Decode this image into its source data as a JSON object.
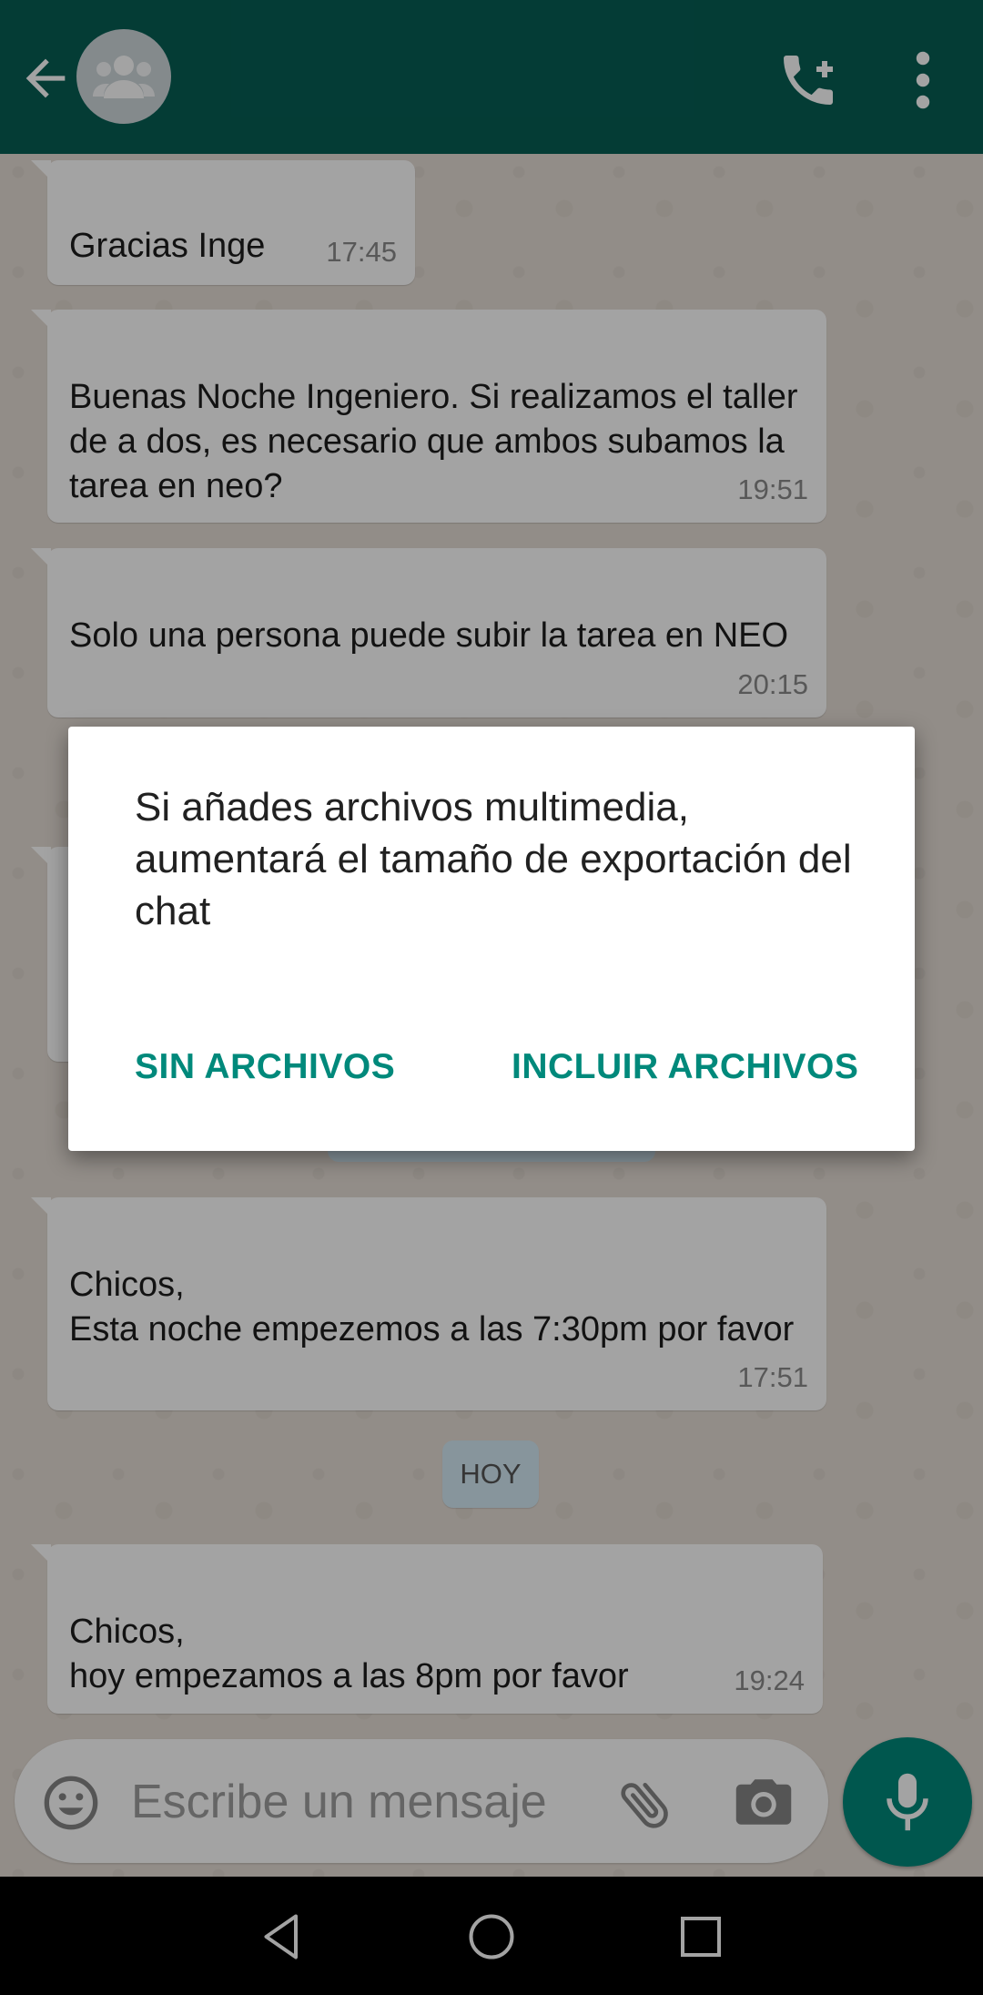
{
  "header": {
    "back_icon": "arrow-back-icon",
    "avatar_icon": "group-avatar-icon",
    "call_icon": "add-call-icon",
    "menu_icon": "more-vert-icon",
    "bg_color": "#075e54"
  },
  "messages": [
    {
      "text": "Gracias Inge",
      "time": "17:45"
    },
    {
      "text": "Buenas Noche Ingeniero. Si realizamos el taller de a dos, es necesario que ambos subamos la tarea en neo?",
      "time": "19:51"
    },
    {
      "text": "Solo una persona puede subir la tarea en NEO",
      "time": "20:15"
    },
    {
      "text": "Chicos,\nEsta noche empezemos a las 7:30pm por favor",
      "time": "17:51"
    },
    {
      "text": "Chicos,\nhoy empezamos a las 8pm por favor",
      "time": "19:24"
    }
  ],
  "day_divider": "HOY",
  "composer": {
    "placeholder": "Escribe un mensaje",
    "emoji_icon": "emoji-icon",
    "attach_icon": "paperclip-icon",
    "camera_icon": "camera-icon",
    "mic_icon": "microphone-icon",
    "accent_color": "#00897b"
  },
  "dialog": {
    "message": "Si añades archivos multimedia, aumentará el tamaño de exportación del chat",
    "negative_label": "SIN ARCHIVOS",
    "positive_label": "INCLUIR ARCHIVOS"
  },
  "navbar": {
    "back_icon": "nav-back-icon",
    "home_icon": "nav-home-icon",
    "recents_icon": "nav-recents-icon"
  }
}
